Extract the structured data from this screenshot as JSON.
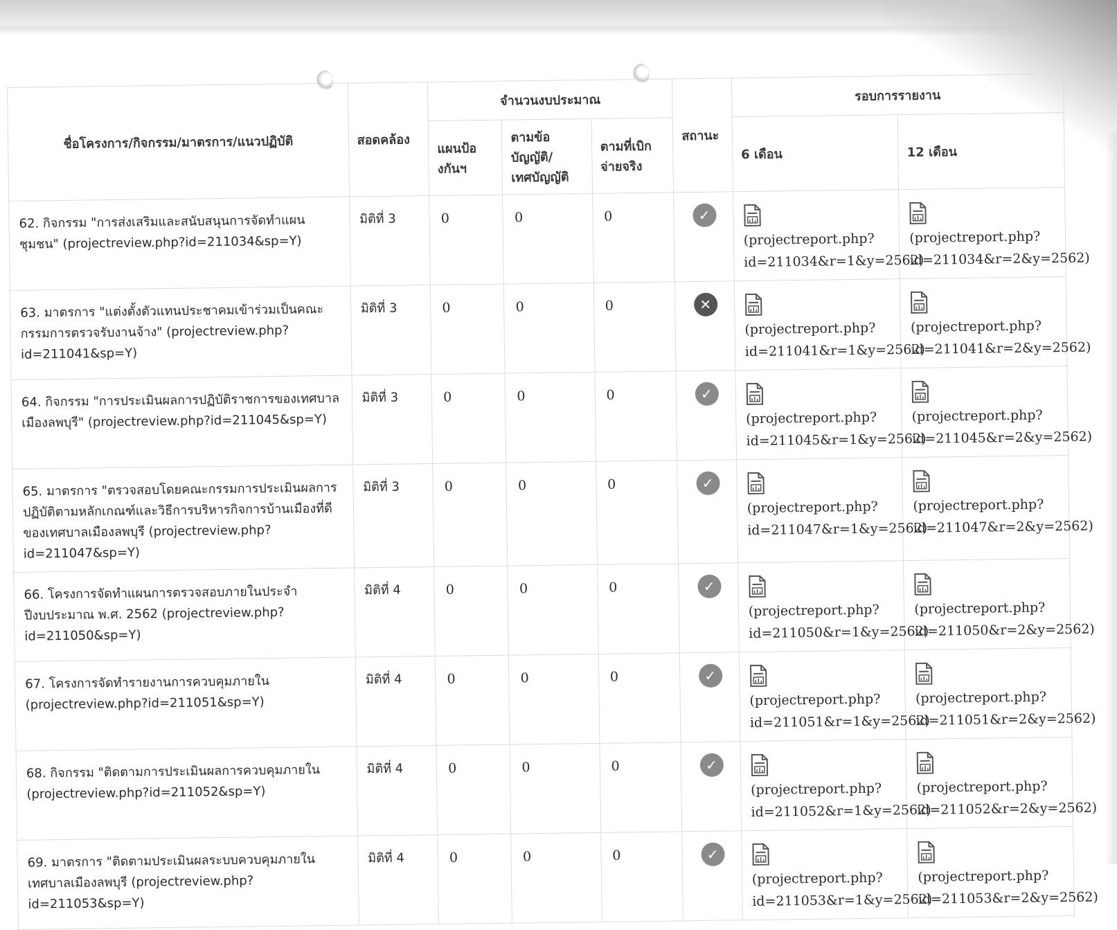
{
  "headers": {
    "name": "ชื่อโครงการ/กิจกรรม/มาตรการ/แนวปฏิบัติ",
    "consistent": "สอดคล้อง",
    "budget_group": "จำนวนงบประมาณ",
    "budget_plan": "แผนป้องกันฯ",
    "budget_law": "ตามข้อบัญญัติ/เทศบัญญัติ",
    "budget_actual": "ตามที่เบิกจ่ายจริง",
    "status": "สถานะ",
    "report_group": "รอบการรายงาน",
    "report_6": "6 เดือน",
    "report_12": "12 เดือน"
  },
  "rows": [
    {
      "title": "62. กิจกรรม \"การส่งเสริมและสนับสนุนการจัดทำแผนชุมชน\" (projectreview.php?id=211034&sp=Y)",
      "dim": "มิติที่ 3",
      "plan": "0",
      "law": "0",
      "actual": "0",
      "status": "ok",
      "status_icon": "check-circle-icon",
      "r6": "(projectreport.php?id=211034&r=1&y=2562)",
      "r12": "(projectreport.php?id=211034&r=2&y=2562)"
    },
    {
      "title": "63. มาตรการ \"แต่งตั้งตัวแทนประชาคมเข้าร่วมเป็นคณะกรรมการตรวจรับงานจ้าง\" (projectreview.php?id=211041&sp=Y)",
      "dim": "มิติที่ 3",
      "plan": "0",
      "law": "0",
      "actual": "0",
      "status": "fail",
      "status_icon": "x-circle-icon",
      "r6": "(projectreport.php?id=211041&r=1&y=2562)",
      "r12": "(projectreport.php?id=211041&r=2&y=2562)"
    },
    {
      "title": "64. กิจกรรม \"การประเมินผลการปฏิบัติราชการของเทศบาลเมืองลพบุรี\" (projectreview.php?id=211045&sp=Y)",
      "dim": "มิติที่ 3",
      "plan": "0",
      "law": "0",
      "actual": "0",
      "status": "ok",
      "status_icon": "check-circle-icon",
      "r6": "(projectreport.php?id=211045&r=1&y=2562)",
      "r12": "(projectreport.php?id=211045&r=2&y=2562)"
    },
    {
      "title": "65. มาตรการ \"ตรวจสอบโดยคณะกรรมการประเมินผลการปฏิบัติตามหลักเกณฑ์และวิธีการบริหารกิจการบ้านเมืองที่ดีของเทศบาลเมืองลพบุรี (projectreview.php?id=211047&sp=Y)",
      "dim": "มิติที่ 3",
      "plan": "0",
      "law": "0",
      "actual": "0",
      "status": "ok",
      "status_icon": "check-circle-icon",
      "r6": "(projectreport.php?id=211047&r=1&y=2562)",
      "r12": "(projectreport.php?id=211047&r=2&y=2562)"
    },
    {
      "title": "66. โครงการจัดทำแผนการตรวจสอบภายในประจำปีงบประมาณ พ.ศ. 2562 (projectreview.php?id=211050&sp=Y)",
      "dim": "มิติที่ 4",
      "plan": "0",
      "law": "0",
      "actual": "0",
      "status": "ok",
      "status_icon": "check-circle-icon",
      "r6": "(projectreport.php?id=211050&r=1&y=2562)",
      "r12": "(projectreport.php?id=211050&r=2&y=2562)"
    },
    {
      "title": "67. โครงการจัดทำรายงานการควบคุมภายใน (projectreview.php?id=211051&sp=Y)",
      "dim": "มิติที่ 4",
      "plan": "0",
      "law": "0",
      "actual": "0",
      "status": "ok",
      "status_icon": "check-circle-icon",
      "r6": "(projectreport.php?id=211051&r=1&y=2562)",
      "r12": "(projectreport.php?id=211051&r=2&y=2562)"
    },
    {
      "title": "68. กิจกรรม \"ติดตามการประเมินผลการควบคุมภายใน (projectreview.php?id=211052&sp=Y)",
      "dim": "มิติที่ 4",
      "plan": "0",
      "law": "0",
      "actual": "0",
      "status": "ok",
      "status_icon": "check-circle-icon",
      "r6": "(projectreport.php?id=211052&r=1&y=2562)",
      "r12": "(projectreport.php?id=211052&r=2&y=2562)"
    },
    {
      "title": "69. มาตรการ \"ติดตามประเมินผลระบบควบคุมภายในเทศบาลเมืองลพบุรี (projectreview.php?id=211053&sp=Y)",
      "dim": "มิติที่ 4",
      "plan": "0",
      "law": "0",
      "actual": "0",
      "status": "ok",
      "status_icon": "check-circle-icon",
      "r6": "(projectreport.php?id=211053&r=1&y=2562)",
      "r12": "(projectreport.php?id=211053&r=2&y=2562)"
    }
  ],
  "icons": {
    "report": "document-chart-icon"
  },
  "colors": {
    "status_ok": "#8a8a8a",
    "status_fail": "#555555",
    "border": "#dcdcdc"
  }
}
